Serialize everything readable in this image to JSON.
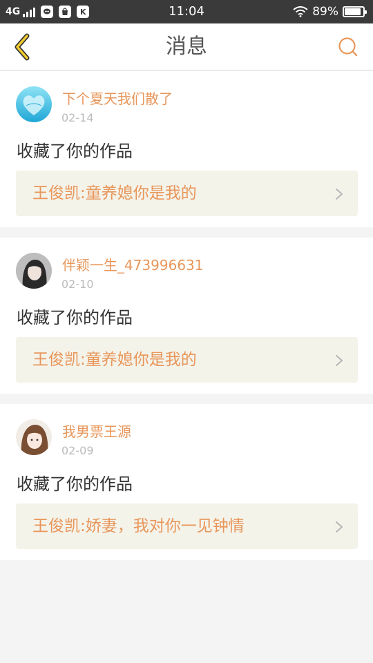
{
  "status_bar": {
    "network": "4G",
    "time": "11:04",
    "battery_percent": "89%",
    "battery_level": 0.89,
    "icons": [
      "signal-icon",
      "chat-app-icon",
      "bag-app-icon",
      "k-app-icon",
      "wifi-icon",
      "battery-icon"
    ]
  },
  "header": {
    "title": "消息",
    "back_icon": "chevron-left-icon",
    "search_icon": "search-icon",
    "accent_color": "#e8965a"
  },
  "messages": [
    {
      "username": "下个夏天我们散了",
      "date": "02-14",
      "action": "收藏了你的作品",
      "work_title": "王俊凯:童养媳你是我的"
    },
    {
      "username": "伴颖一生_473996631",
      "date": "02-10",
      "action": "收藏了你的作品",
      "work_title": "王俊凯:童养媳你是我的"
    },
    {
      "username": "我男票王源",
      "date": "02-09",
      "action": "收藏了你的作品",
      "work_title": "王俊凯:娇妻，我对你一见钟情"
    }
  ]
}
